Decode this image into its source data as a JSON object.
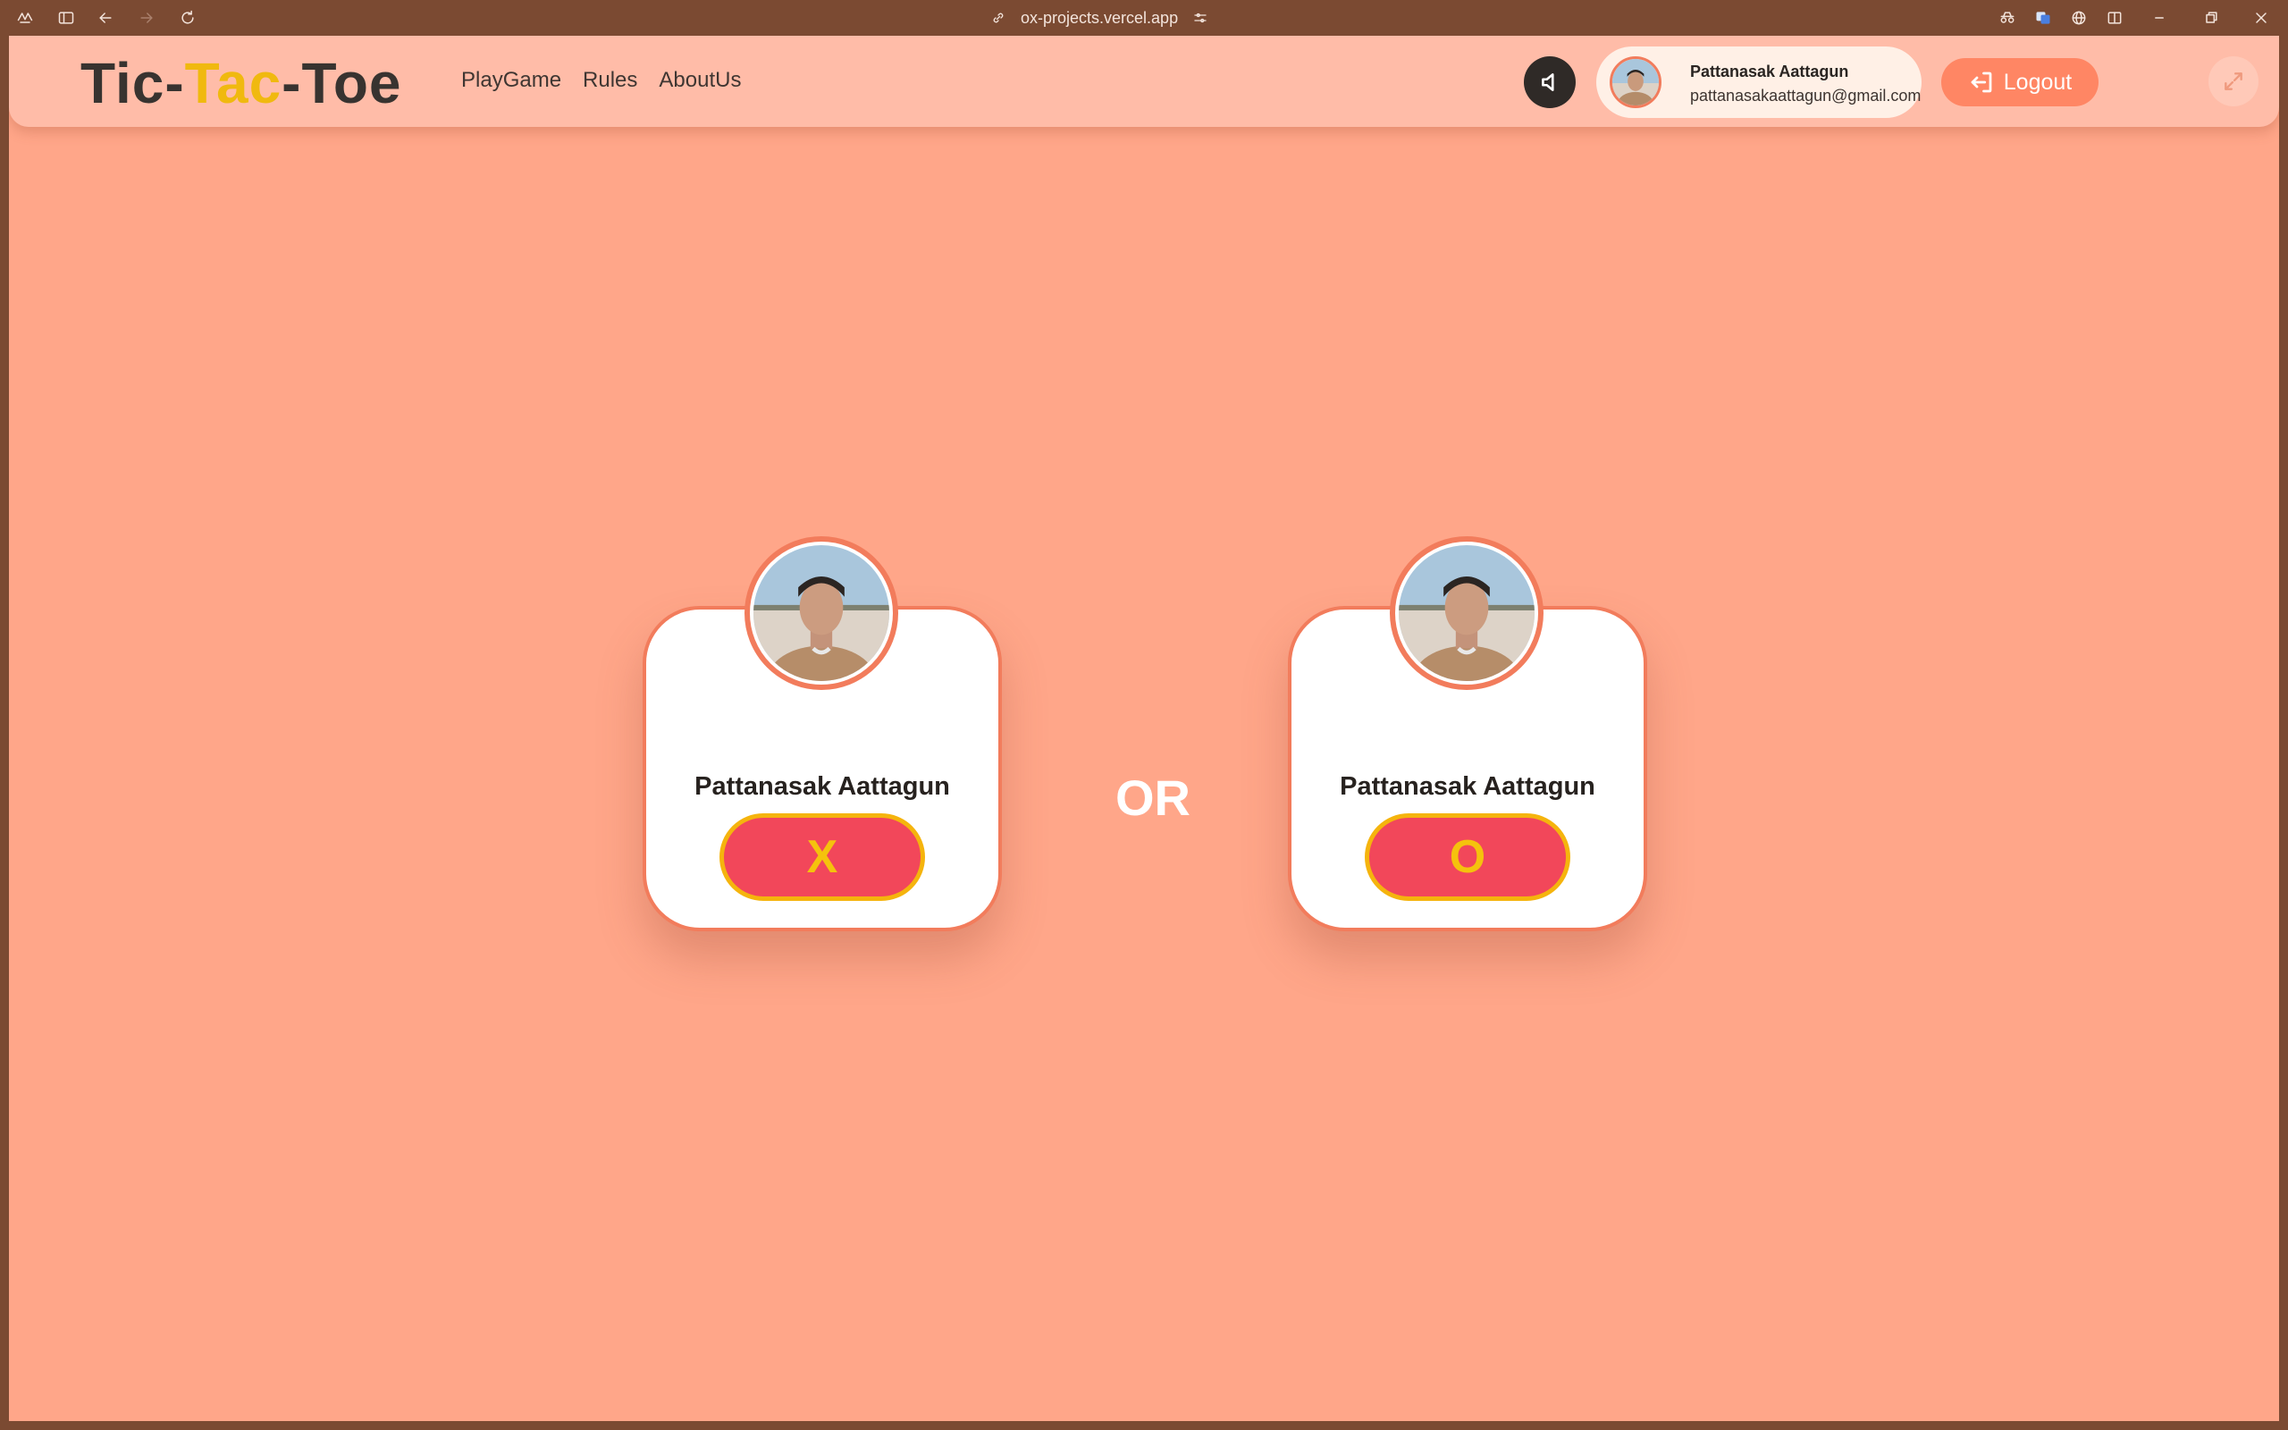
{
  "browser": {
    "url": "ox-projects.vercel.app"
  },
  "navbar": {
    "brand": {
      "part1": "Tic-",
      "part2": "Tac",
      "part3": "-Toe"
    },
    "links": [
      "PlayGame",
      "Rules",
      "AboutUs"
    ],
    "user": {
      "name": "Pattanasak Aattagun",
      "email": "pattanasakaattagun@gmail.com"
    },
    "logout_label": "Logout"
  },
  "main": {
    "players": [
      {
        "name": "Pattanasak Aattagun",
        "symbol": "X"
      },
      {
        "name": "Pattanasak Aattagun",
        "symbol": "O"
      }
    ],
    "separator": "OR"
  },
  "colors": {
    "page_background": "#ffa689",
    "navbar_background": "#ffbca8",
    "accent_orange": "#f27c5c",
    "brand_yellow": "#f0b90f",
    "symbol_button": "#f2475a",
    "symbol_border": "#f5b40d",
    "browser_chrome": "#7b4a32"
  }
}
